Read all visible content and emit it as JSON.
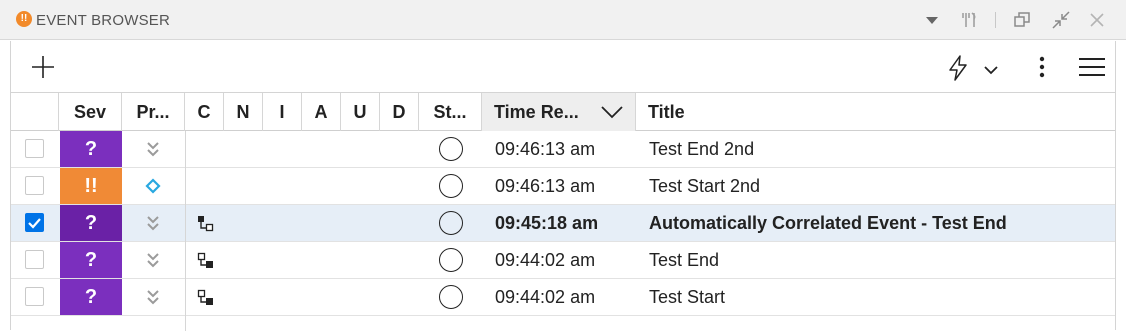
{
  "window": {
    "title": "EVENT BROWSER",
    "badge_icon": "app-alert-icon",
    "controls": [
      "dropdown-icon",
      "filter-tools-icon",
      "popout-icon",
      "collapse-icon",
      "close-icon"
    ]
  },
  "toolbar": {
    "add_icon": "plus-icon",
    "actions_icon": "lightning-icon",
    "actions_dropdown_icon": "chevron-down-icon",
    "more_icon": "kebab-icon",
    "menu_icon": "hamburger-icon"
  },
  "columns": {
    "sev": "Sev",
    "priority": "Pr...",
    "c": "C",
    "n": "N",
    "i": "I",
    "a": "A",
    "u": "U",
    "d": "D",
    "state": "St...",
    "time": "Time Re...",
    "title": "Title",
    "sort_icon": "sort-descending-icon"
  },
  "colors": {
    "unknown": "#7b2fbe",
    "unknown_selected": "#6a21a6",
    "major": "#f08a36",
    "checkbox_checked": "#0073e7",
    "selected_row": "#e6eef7",
    "priority_icon": "#9b9b9b",
    "priority_highest": "#29a8e0"
  },
  "rows": [
    {
      "checked": false,
      "severity": "?",
      "severity_type": "unknown",
      "priority_icon": "priority-lowest-icon",
      "correlation_icon": "",
      "state_icon": "open-circle-icon",
      "time": "09:46:13 am",
      "title": "Test End 2nd"
    },
    {
      "checked": false,
      "severity": "!!",
      "severity_type": "major",
      "priority_icon": "priority-diamond-icon",
      "correlation_icon": "",
      "state_icon": "open-circle-icon",
      "time": "09:46:13 am",
      "title": "Test Start 2nd"
    },
    {
      "checked": true,
      "severity": "?",
      "severity_type": "unknown",
      "priority_icon": "priority-lowest-icon",
      "correlation_icon": "correlation-cause-icon",
      "state_icon": "open-circle-icon",
      "time": "09:45:18 am",
      "title": "Automatically Correlated Event - Test End"
    },
    {
      "checked": false,
      "severity": "?",
      "severity_type": "unknown",
      "priority_icon": "priority-lowest-icon",
      "correlation_icon": "correlation-symptom-icon",
      "state_icon": "open-circle-icon",
      "time": "09:44:02 am",
      "title": "Test End"
    },
    {
      "checked": false,
      "severity": "?",
      "severity_type": "unknown",
      "priority_icon": "priority-lowest-icon",
      "correlation_icon": "correlation-symptom-icon",
      "state_icon": "open-circle-icon",
      "time": "09:44:02 am",
      "title": "Test Start"
    }
  ]
}
